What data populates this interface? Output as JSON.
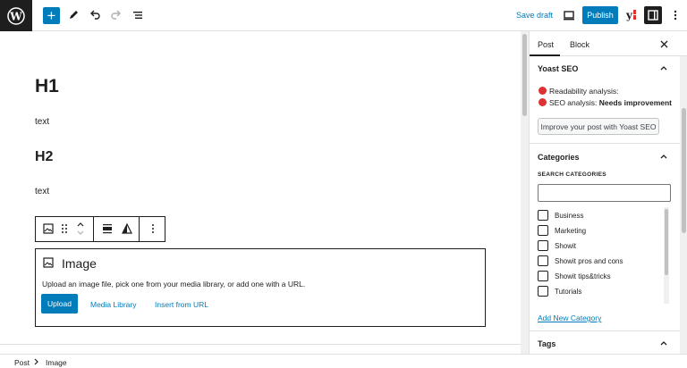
{
  "toolbar": {
    "save_draft": "Save draft",
    "publish": "Publish",
    "add_icon": "+"
  },
  "editor": {
    "heading1": "H1",
    "paragraph1": "text",
    "heading2": "H2",
    "paragraph2": "text",
    "image_block": {
      "title": "Image",
      "description": "Upload an image file, pick one from your media library, or add one with a URL.",
      "upload": "Upload",
      "media_library": "Media Library",
      "insert_url": "Insert from URL"
    }
  },
  "sidebar": {
    "tabs": [
      "Post",
      "Block"
    ],
    "yoast": {
      "title": "Yoast SEO",
      "readability": "Readability analysis:",
      "seo_prefix": "SEO analysis:",
      "seo_status": "Needs improvement",
      "button": "Improve your post with Yoast SEO"
    },
    "categories": {
      "title": "Categories",
      "search_label": "SEARCH CATEGORIES",
      "items": [
        "Business",
        "Marketing",
        "Showit",
        "Showit pros and cons",
        "Showit tips&tricks",
        "Tutorials"
      ],
      "add_new": "Add New Category"
    },
    "tags": {
      "title": "Tags"
    }
  },
  "status_bar": {
    "crumbs": [
      "Post",
      "Image"
    ]
  },
  "colors": {
    "accent": "#007cba",
    "dark": "#1e1e1e",
    "error": "#dc3232"
  }
}
